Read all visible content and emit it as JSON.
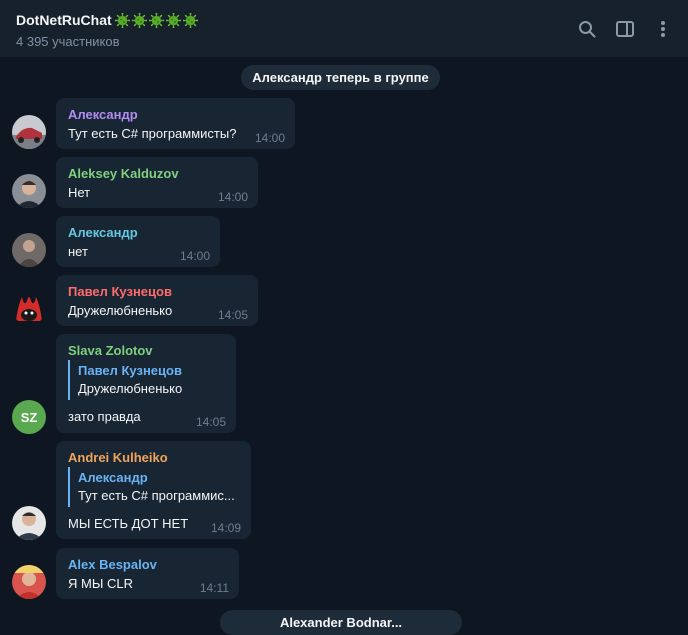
{
  "header": {
    "title": "DotNetRuChat",
    "emoji_icon": "virus-icon",
    "emoji_count": 5,
    "members": "4 395 участников",
    "icons": [
      "search-icon",
      "sidebar-toggle-icon",
      "more-icon"
    ]
  },
  "service_top": "Александр теперь в группе",
  "service_bottom": "Alexander Bodnar...",
  "colors": {
    "bg": "#0e1621",
    "bubble": "#182533",
    "purple": "#b38cf3",
    "green": "#7fd07f",
    "cyan": "#65c7e0",
    "red": "#ff6b6b",
    "orange": "#f0a35a",
    "blue": "#6ab3f3"
  },
  "messages": [
    {
      "sender": "Александр",
      "text": "Тут есть C# программисты?",
      "time": "14:00"
    },
    {
      "sender": "Aleksey Kalduzov",
      "text": "Нет",
      "time": "14:00"
    },
    {
      "sender": "Александр",
      "text": "нет",
      "time": "14:00"
    },
    {
      "sender": "Павел Кузнецов",
      "text": "Дружелюбненько",
      "time": "14:05"
    },
    {
      "sender": "Slava Zolotov",
      "reply_name": "Павел Кузнецов",
      "reply_text": "Дружелюбненько",
      "text": "зато правда",
      "time": "14:05",
      "avatar_initials": "SZ"
    },
    {
      "sender": "Andrei Kulheiko",
      "reply_name": "Александр",
      "reply_text": "Тут есть C# программис...",
      "text": "МЫ ЕСТЬ ДОТ НЕТ",
      "time": "14:09"
    },
    {
      "sender": "Alex Bespalov",
      "text": "Я МЫ CLR",
      "time": "14:11"
    }
  ]
}
